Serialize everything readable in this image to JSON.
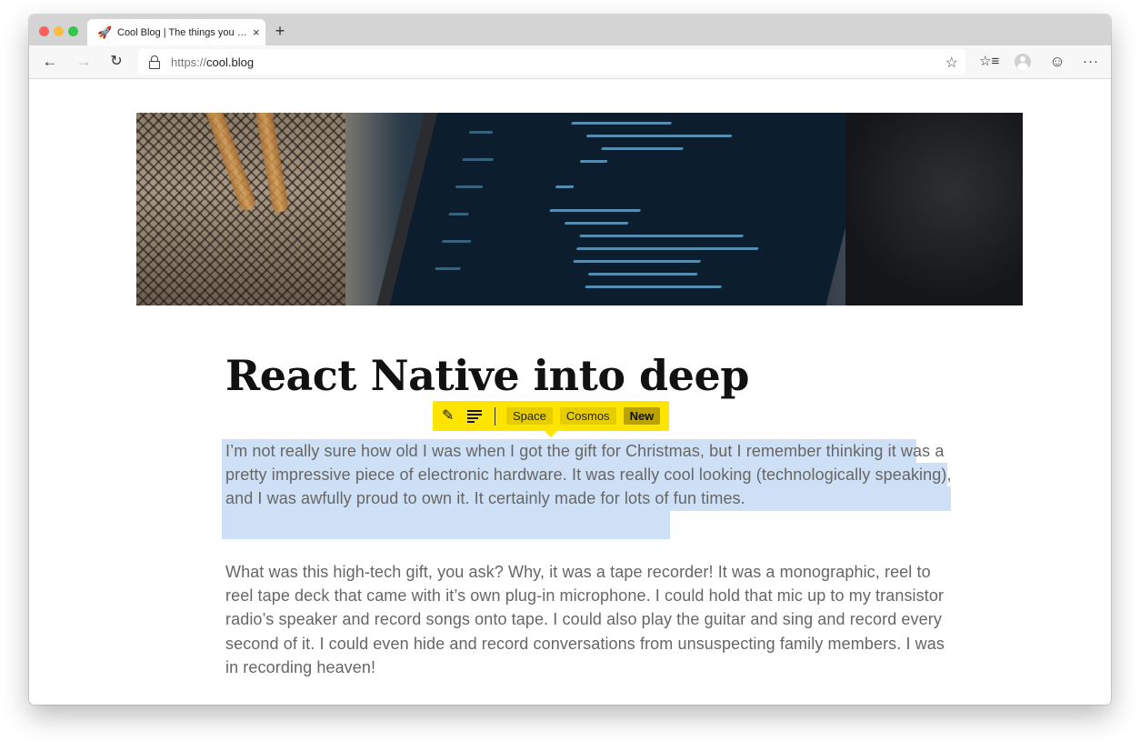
{
  "browser": {
    "tab_title": "Cool Blog | The things you love",
    "tab_favicon": "🚀",
    "close_glyph": "×",
    "new_tab_glyph": "+",
    "url_scheme": "https://",
    "url_host": "cool.blog",
    "icons": {
      "back": "←",
      "forward": "→",
      "reload": "↻",
      "star": "☆",
      "favorites": "☆≡",
      "feedback": "☺",
      "more": "···"
    }
  },
  "article": {
    "title": "React Native into deep",
    "paragraphs": [
      "I’m not really sure how old I was when I got the gift for Christmas, but I remember thinking it was a pretty impressive piece of electronic hardware. It was really cool looking (technologically speaking), and I was awfully proud to own it. It certainly made for lots of fun times.",
      "What was this high-tech gift, you ask? Why, it was a tape recorder! It was a monographic, reel to reel tape deck that came with it’s own plug-in microphone. I could hold that mic up to my transistor radio’s speaker and record songs onto tape. I could also play the guitar and sing and record every second of it. I could even hide and record conversations from unsuspecting family members. I was in recording heaven!"
    ]
  },
  "annotation_toolbar": {
    "pen_glyph": "✎",
    "tags": [
      "Space",
      "Cosmos"
    ],
    "new_tag_label": "New"
  },
  "colors": {
    "toolbar_accent": "#ffe400",
    "selection": "#cde0f5"
  }
}
